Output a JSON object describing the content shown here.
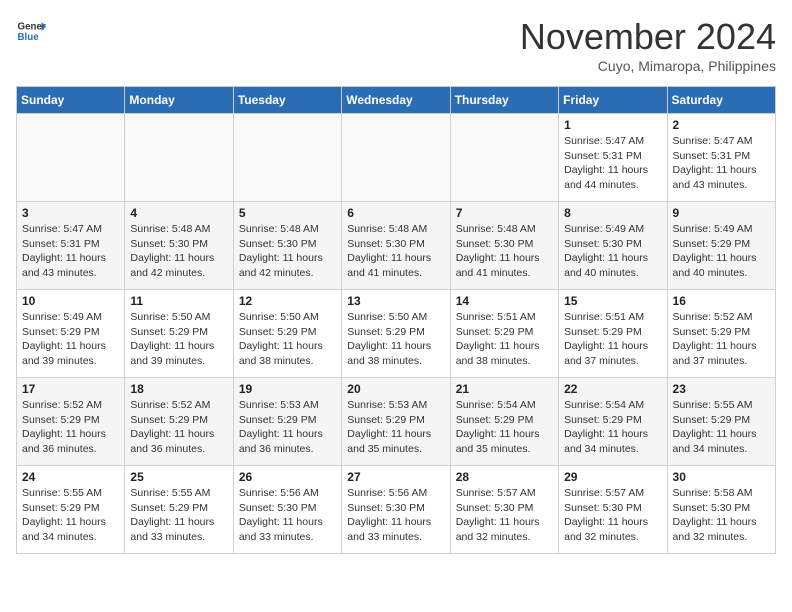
{
  "logo": {
    "line1": "General",
    "line2": "Blue"
  },
  "title": "November 2024",
  "location": "Cuyo, Mimaropa, Philippines",
  "weekdays": [
    "Sunday",
    "Monday",
    "Tuesday",
    "Wednesday",
    "Thursday",
    "Friday",
    "Saturday"
  ],
  "weeks": [
    [
      {
        "day": "",
        "info": ""
      },
      {
        "day": "",
        "info": ""
      },
      {
        "day": "",
        "info": ""
      },
      {
        "day": "",
        "info": ""
      },
      {
        "day": "",
        "info": ""
      },
      {
        "day": "1",
        "info": "Sunrise: 5:47 AM\nSunset: 5:31 PM\nDaylight: 11 hours\nand 44 minutes."
      },
      {
        "day": "2",
        "info": "Sunrise: 5:47 AM\nSunset: 5:31 PM\nDaylight: 11 hours\nand 43 minutes."
      }
    ],
    [
      {
        "day": "3",
        "info": "Sunrise: 5:47 AM\nSunset: 5:31 PM\nDaylight: 11 hours\nand 43 minutes."
      },
      {
        "day": "4",
        "info": "Sunrise: 5:48 AM\nSunset: 5:30 PM\nDaylight: 11 hours\nand 42 minutes."
      },
      {
        "day": "5",
        "info": "Sunrise: 5:48 AM\nSunset: 5:30 PM\nDaylight: 11 hours\nand 42 minutes."
      },
      {
        "day": "6",
        "info": "Sunrise: 5:48 AM\nSunset: 5:30 PM\nDaylight: 11 hours\nand 41 minutes."
      },
      {
        "day": "7",
        "info": "Sunrise: 5:48 AM\nSunset: 5:30 PM\nDaylight: 11 hours\nand 41 minutes."
      },
      {
        "day": "8",
        "info": "Sunrise: 5:49 AM\nSunset: 5:30 PM\nDaylight: 11 hours\nand 40 minutes."
      },
      {
        "day": "9",
        "info": "Sunrise: 5:49 AM\nSunset: 5:29 PM\nDaylight: 11 hours\nand 40 minutes."
      }
    ],
    [
      {
        "day": "10",
        "info": "Sunrise: 5:49 AM\nSunset: 5:29 PM\nDaylight: 11 hours\nand 39 minutes."
      },
      {
        "day": "11",
        "info": "Sunrise: 5:50 AM\nSunset: 5:29 PM\nDaylight: 11 hours\nand 39 minutes."
      },
      {
        "day": "12",
        "info": "Sunrise: 5:50 AM\nSunset: 5:29 PM\nDaylight: 11 hours\nand 38 minutes."
      },
      {
        "day": "13",
        "info": "Sunrise: 5:50 AM\nSunset: 5:29 PM\nDaylight: 11 hours\nand 38 minutes."
      },
      {
        "day": "14",
        "info": "Sunrise: 5:51 AM\nSunset: 5:29 PM\nDaylight: 11 hours\nand 38 minutes."
      },
      {
        "day": "15",
        "info": "Sunrise: 5:51 AM\nSunset: 5:29 PM\nDaylight: 11 hours\nand 37 minutes."
      },
      {
        "day": "16",
        "info": "Sunrise: 5:52 AM\nSunset: 5:29 PM\nDaylight: 11 hours\nand 37 minutes."
      }
    ],
    [
      {
        "day": "17",
        "info": "Sunrise: 5:52 AM\nSunset: 5:29 PM\nDaylight: 11 hours\nand 36 minutes."
      },
      {
        "day": "18",
        "info": "Sunrise: 5:52 AM\nSunset: 5:29 PM\nDaylight: 11 hours\nand 36 minutes."
      },
      {
        "day": "19",
        "info": "Sunrise: 5:53 AM\nSunset: 5:29 PM\nDaylight: 11 hours\nand 36 minutes."
      },
      {
        "day": "20",
        "info": "Sunrise: 5:53 AM\nSunset: 5:29 PM\nDaylight: 11 hours\nand 35 minutes."
      },
      {
        "day": "21",
        "info": "Sunrise: 5:54 AM\nSunset: 5:29 PM\nDaylight: 11 hours\nand 35 minutes."
      },
      {
        "day": "22",
        "info": "Sunrise: 5:54 AM\nSunset: 5:29 PM\nDaylight: 11 hours\nand 34 minutes."
      },
      {
        "day": "23",
        "info": "Sunrise: 5:55 AM\nSunset: 5:29 PM\nDaylight: 11 hours\nand 34 minutes."
      }
    ],
    [
      {
        "day": "24",
        "info": "Sunrise: 5:55 AM\nSunset: 5:29 PM\nDaylight: 11 hours\nand 34 minutes."
      },
      {
        "day": "25",
        "info": "Sunrise: 5:55 AM\nSunset: 5:29 PM\nDaylight: 11 hours\nand 33 minutes."
      },
      {
        "day": "26",
        "info": "Sunrise: 5:56 AM\nSunset: 5:30 PM\nDaylight: 11 hours\nand 33 minutes."
      },
      {
        "day": "27",
        "info": "Sunrise: 5:56 AM\nSunset: 5:30 PM\nDaylight: 11 hours\nand 33 minutes."
      },
      {
        "day": "28",
        "info": "Sunrise: 5:57 AM\nSunset: 5:30 PM\nDaylight: 11 hours\nand 32 minutes."
      },
      {
        "day": "29",
        "info": "Sunrise: 5:57 AM\nSunset: 5:30 PM\nDaylight: 11 hours\nand 32 minutes."
      },
      {
        "day": "30",
        "info": "Sunrise: 5:58 AM\nSunset: 5:30 PM\nDaylight: 11 hours\nand 32 minutes."
      }
    ]
  ]
}
